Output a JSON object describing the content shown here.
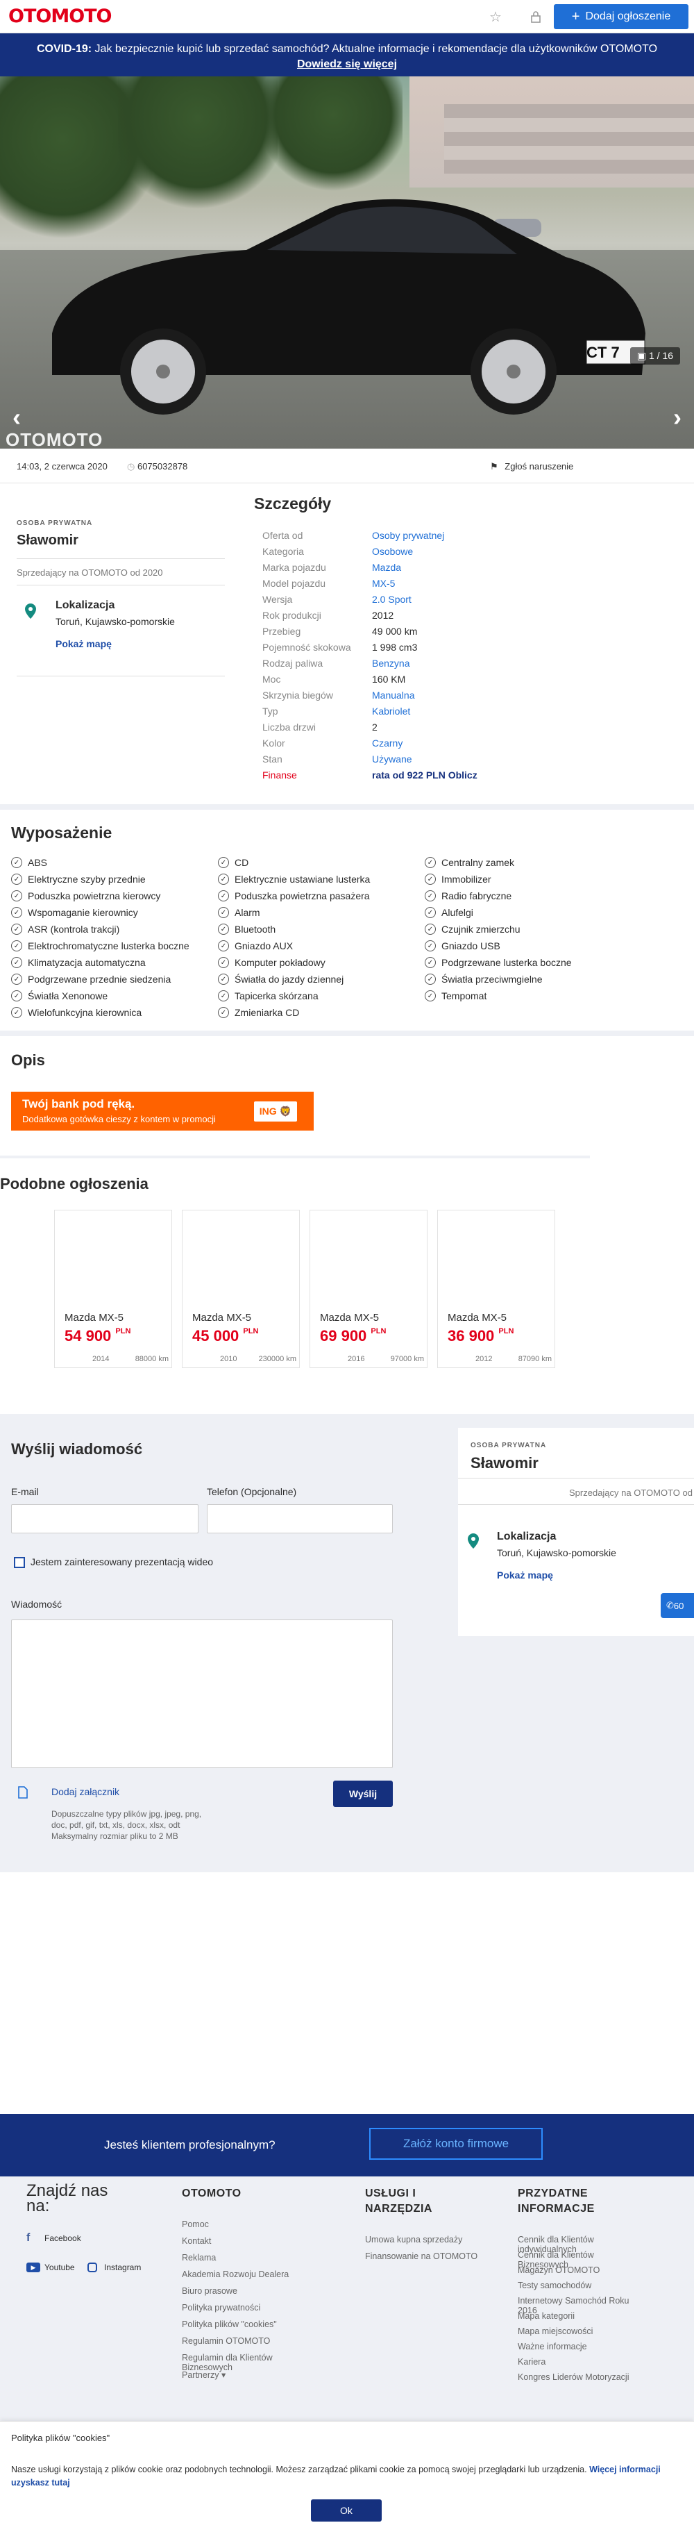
{
  "header": {
    "logo": "OTOMOTO",
    "add_label": "Dodaj ogłoszenie",
    "star_icon": "star-icon",
    "lock_icon": "lock-icon"
  },
  "covid": {
    "bold": "COVID-19:",
    "text": " Jak bezpiecznie kupić lub sprzedać samochód? Aktualne informacje i rekomendacje dla użytkowników OTOMOTO",
    "link": "Dowiedz się więcej"
  },
  "gallery": {
    "counter": "1 / 16",
    "watermark": "OTOMOTO",
    "plate": "CT 7"
  },
  "meta": {
    "date": "14:03, 2 czerwca 2020",
    "id": "6075032878",
    "report": "Zgłoś naruszenie"
  },
  "seller": {
    "type": "OSOBA PRYWATNA",
    "name": "Sławomir",
    "since": "Sprzedający na OTOMOTO od 2020",
    "loc_title": "Lokalizacja",
    "loc_value": "Toruń, Kujawsko-pomorskie",
    "map": "Pokaż mapę"
  },
  "details": {
    "title": "Szczegóły",
    "rows": [
      {
        "k": "Oferta od",
        "v": "Osoby prywatnej"
      },
      {
        "k": "Kategoria",
        "v": "Osobowe"
      },
      {
        "k": "Marka pojazdu",
        "v": "Mazda"
      },
      {
        "k": "Model pojazdu",
        "v": "MX-5"
      },
      {
        "k": "Wersja",
        "v": "2.0 Sport"
      },
      {
        "k": "Rok produkcji",
        "v": "2012"
      },
      {
        "k": "Przebieg",
        "v": "49 000 km"
      },
      {
        "k": "Pojemność skokowa",
        "v": "1 998 cm3"
      },
      {
        "k": "Rodzaj paliwa",
        "v": "Benzyna"
      },
      {
        "k": "Moc",
        "v": "160 KM"
      },
      {
        "k": "Skrzynia biegów",
        "v": "Manualna"
      },
      {
        "k": "Typ",
        "v": "Kabriolet"
      },
      {
        "k": "Liczba drzwi",
        "v": "2"
      },
      {
        "k": "Kolor",
        "v": "Czarny"
      },
      {
        "k": "Stan",
        "v": "Używane"
      },
      {
        "k": "Finanse",
        "v": "rata od 922 PLN Oblicz"
      }
    ]
  },
  "equipment": {
    "title": "Wyposażenie",
    "col1": [
      "ABS",
      "Elektryczne szyby przednie",
      "Poduszka powietrzna kierowcy",
      "Wspomaganie kierownicy",
      "ASR (kontrola trakcji)",
      "Elektrochromatyczne lusterka boczne",
      "Klimatyzacja automatyczna",
      "Podgrzewane przednie siedzenia",
      "Światła Xenonowe",
      "Wielofunkcyjna kierownica"
    ],
    "col2": [
      "CD",
      "Elektrycznie ustawiane lusterka",
      "Poduszka powietrzna pasażera",
      "Alarm",
      "Bluetooth",
      "Gniazdo AUX",
      "Komputer pokładowy",
      "Światła do jazdy dziennej",
      "Tapicerka skórzana",
      "Zmieniarka CD"
    ],
    "col3": [
      "Centralny zamek",
      "Immobilizer",
      "Radio fabryczne",
      "Alufelgi",
      "Czujnik zmierzchu",
      "Gniazdo USB",
      "Podgrzewane lusterka boczne",
      "Światła przeciwmgielne",
      "Tempomat"
    ]
  },
  "description": {
    "title": "Opis",
    "ing_title": "Twój bank pod ręką.",
    "ing_sub": "Dodatkowa gotówka cieszy z kontem w promocji",
    "ing_logo": "ING"
  },
  "similar": {
    "title": "Podobne ogłoszenia",
    "cards": [
      {
        "title": "Mazda MX-5",
        "price": "54 900",
        "cur": "PLN",
        "year": "2014",
        "km": "88000 km"
      },
      {
        "title": "Mazda MX-5",
        "price": "45 000",
        "cur": "PLN",
        "year": "2010",
        "km": "230000 km"
      },
      {
        "title": "Mazda MX-5",
        "price": "69 900",
        "cur": "PLN",
        "year": "2016",
        "km": "97000 km"
      },
      {
        "title": "Mazda MX-5",
        "price": "36 900",
        "cur": "PLN",
        "year": "2012",
        "km": "87090 km"
      }
    ]
  },
  "message": {
    "title": "Wyślij wiadomość",
    "email_label": "E-mail",
    "phone_label": "Telefon (Opcjonalne)",
    "video_label": "Jestem zainteresowany prezentacją wideo",
    "msg_label": "Wiadomość",
    "attach": "Dodaj załącznik",
    "attach_note1": "Dopuszczalne typy plików jpg, jpeg, png,",
    "attach_note2": "doc, pdf, gif, txt, xls, docx, xlsx, odt",
    "attach_note3": "Maksymalny rozmiar pliku to 2 MB",
    "send": "Wyślij",
    "seller_type": "OSOBA PRYWATNA",
    "seller_name": "Sławomir",
    "seller_since": "Sprzedający na OTOMOTO od",
    "loc_title": "Lokalizacja",
    "loc_value": "Toruń, Kujawsko-pomorskie",
    "map": "Pokaż mapę",
    "phone_btn": "60"
  },
  "pro": {
    "text": "Jesteś klientem profesjonalnym?",
    "button": "Załóż konto firmowe"
  },
  "footer": {
    "find_title": "Znajdź nas na:",
    "facebook": "Facebook",
    "youtube": "Youtube",
    "instagram": "Instagram",
    "col1_title": "OTOMOTO",
    "col1": [
      "Pomoc",
      "Kontakt",
      "Reklama",
      "Akademia Rozwoju Dealera",
      "Biuro prasowe",
      "Polityka prywatności",
      "Polityka plików \"cookies\"",
      "Regulamin OTOMOTO",
      "Regulamin dla Klientów Biznesowych",
      "Partnerzy ▾"
    ],
    "col2_title_1": "USŁUGI I",
    "col2_title_2": "NARZĘDZIA",
    "col2": [
      "Umowa kupna sprzedaży",
      "Finansowanie na OTOMOTO"
    ],
    "col3_title_1": "PRZYDATNE",
    "col3_title_2": "INFORMACJE",
    "col3": [
      "Cennik dla Klientów indywidualnych",
      "Cennik dla Klientów Biznesowych",
      "Magazyn OTOMOTO",
      "Testy samochodów",
      "Internetowy Samochód Roku 2016",
      "Mapa kategorii",
      "Mapa miejscowości",
      "Ważne informacje",
      "Kariera",
      "Kongres Liderów Motoryzacji"
    ]
  },
  "cookie": {
    "title": "Polityka plików \"cookies\"",
    "text": "Nasze usługi korzystają z plików cookie oraz podobnych technologii. Możesz zarządzać plikami cookie za pomocą swojej przeglądarki lub urządzenia. ",
    "link": "Więcej informacji uzyskasz tutaj",
    "ok": "Ok"
  }
}
